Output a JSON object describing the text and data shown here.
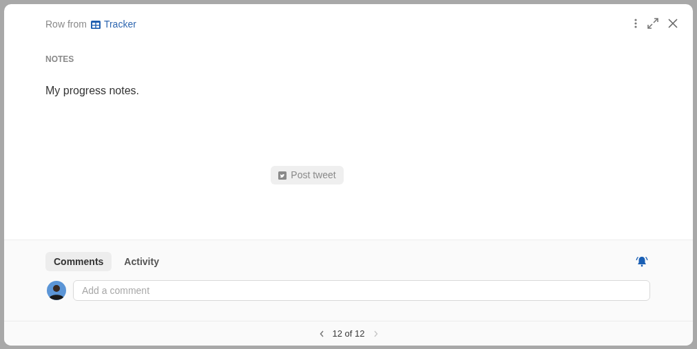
{
  "header": {
    "prefix": "Row from",
    "source": "Tracker"
  },
  "notes": {
    "label": "NOTES",
    "text": "My progress notes."
  },
  "action_button": {
    "label": "Post tweet"
  },
  "tabs": [
    {
      "label": "Comments",
      "selected": true
    },
    {
      "label": "Activity",
      "selected": false
    }
  ],
  "comment": {
    "placeholder": "Add a comment"
  },
  "pager": {
    "text": "12 of 12",
    "prev_disabled": false,
    "next_disabled": true
  }
}
